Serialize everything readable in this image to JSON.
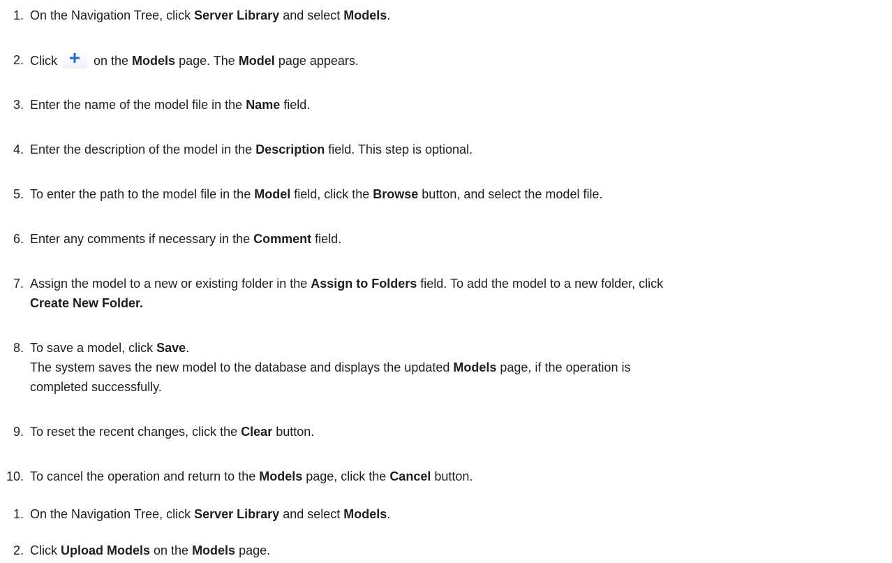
{
  "list1": [
    {
      "num": "1.",
      "t1": "On the Navigation Tree, click ",
      "b1": "Server Library",
      "t2": " and select ",
      "b2": "Models",
      "t3": "."
    },
    {
      "num": "2.",
      "t1": "Click ",
      "icon": "plus-icon",
      "t2": " on the ",
      "b1": "Models",
      "t3": " page. The ",
      "b2": "Model",
      "t4": " page appears."
    },
    {
      "num": "3.",
      "t1": "Enter the name of the model file in the ",
      "b1": "Name",
      "t2": " field."
    },
    {
      "num": "4.",
      "t1": "Enter the description of the model in the ",
      "b1": "Description",
      "t2": " field. This step is optional."
    },
    {
      "num": "5.",
      "t1": "To enter the path to the model file in the ",
      "b1": "Model",
      "t2": " field, click the ",
      "b2": "Browse",
      "t3": " button, and select the model file."
    },
    {
      "num": "6.",
      "t1": "Enter any comments if necessary in the ",
      "b1": "Comment",
      "t2": " field."
    },
    {
      "num": "7.",
      "t1": "Assign the model to a new or existing folder in the ",
      "b1": "Assign to Folders",
      "t2": " field. To add the model to a new folder, click",
      "b2": "Create New Folder."
    },
    {
      "num": "8.",
      "t1": "To save a model, click ",
      "b1": "Save",
      "t2": ".",
      "t3": "The system saves the new model to the database and displays the updated ",
      "b2": "Models",
      "t4": " page, if the operation is",
      "t5": "completed successfully."
    },
    {
      "num": "9.",
      "t1": "To reset the recent changes, click the ",
      "b1": "Clear",
      "t2": " button."
    },
    {
      "num": "10.",
      "t1": "To cancel the operation and return to the ",
      "b1": "Models",
      "t2": " page, click the ",
      "b2": "Cancel",
      "t3": " button."
    }
  ],
  "list2": [
    {
      "num": "1.",
      "t1": "On the Navigation Tree, click ",
      "b1": "Server Library",
      "t2": " and select ",
      "b2": "Models",
      "t3": "."
    },
    {
      "num": "2.",
      "t1": "Click ",
      "b1": "Upload Models",
      "t2": " on the ",
      "b2": "Models",
      "t3": " page."
    }
  ],
  "colors": {
    "text": "#1f1f1f",
    "icon_plus": "#1f6fd1"
  }
}
